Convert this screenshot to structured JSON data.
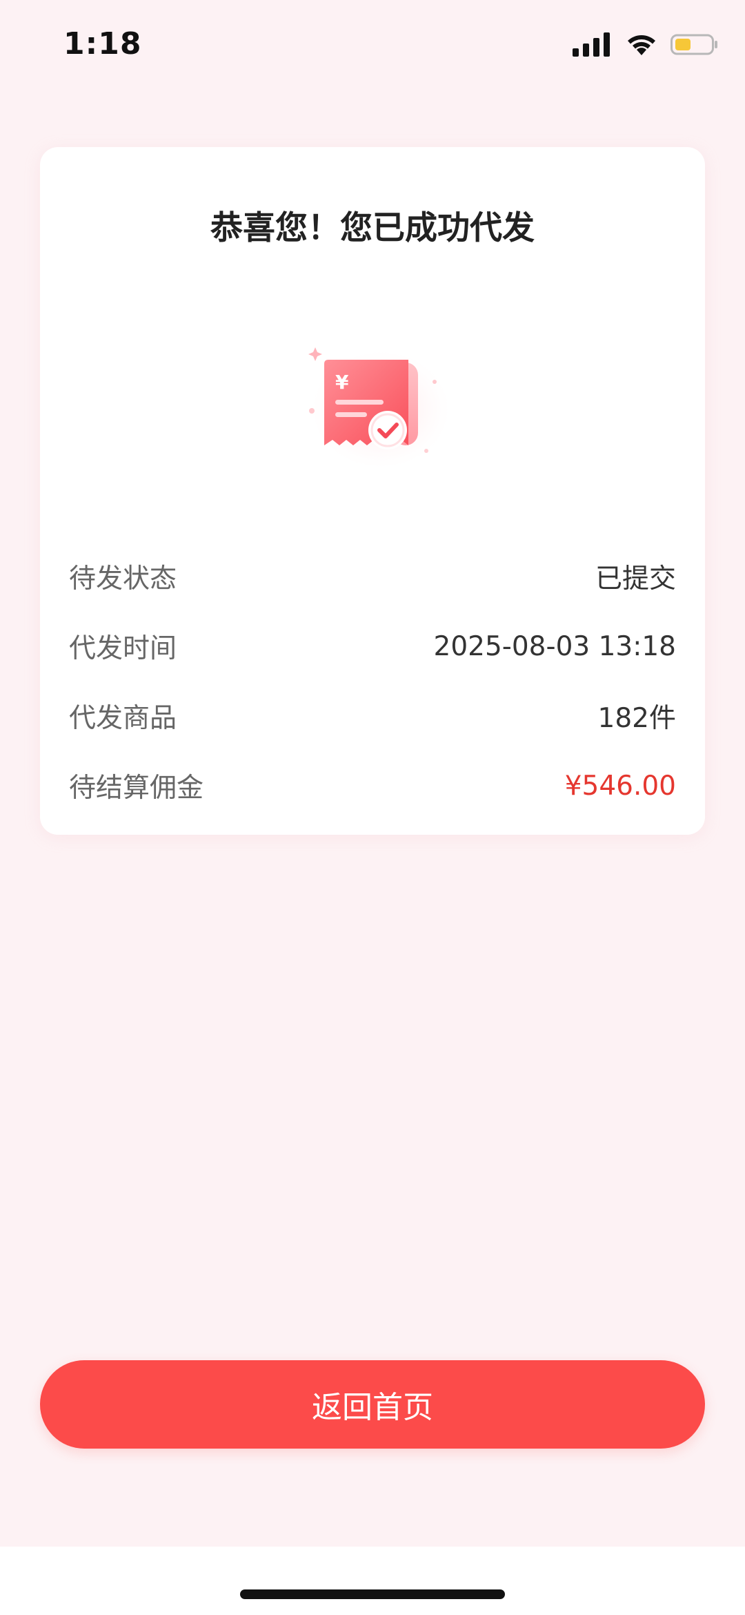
{
  "status_bar": {
    "time": "1:18",
    "icons": [
      "signal-icon",
      "wifi-icon",
      "battery-icon"
    ],
    "battery_color": "#f6c738"
  },
  "card": {
    "title": "恭喜您！您已成功代发",
    "illustration_icon": "receipt-check-icon",
    "rows": [
      {
        "label": "待发状态",
        "value": "已提交"
      },
      {
        "label": "代发时间",
        "value": "2025-08-03 13:18"
      },
      {
        "label": "代发商品",
        "value": "182件"
      },
      {
        "label": "待结算佣金",
        "value": "¥546.00"
      }
    ]
  },
  "button": {
    "label": "返回首页"
  },
  "colors": {
    "accent": "#fc4b4a",
    "amount": "#e5372f",
    "page_background": "#fdf2f4"
  }
}
